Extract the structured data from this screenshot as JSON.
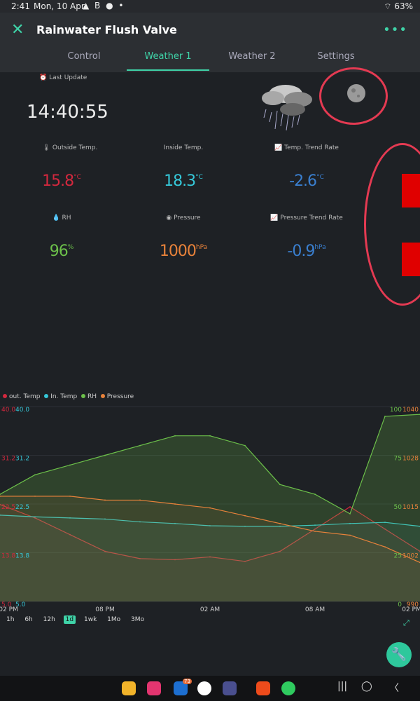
{
  "status": {
    "time": "2:41",
    "date": "Mon, 10 Apr",
    "battery": "63%"
  },
  "app": {
    "title": "Rainwater Flush Valve"
  },
  "tabs": [
    {
      "label": "Control"
    },
    {
      "label": "Weather 1"
    },
    {
      "label": "Weather 2"
    },
    {
      "label": "Settings"
    }
  ],
  "last_update": {
    "label": "Last Update",
    "time": "14:40:55"
  },
  "metrics": {
    "outside": {
      "label": "Outside Temp.",
      "value": "15.8",
      "unit": "°C",
      "color": "#d3283e"
    },
    "inside": {
      "label": "Inside Temp.",
      "value": "18.3",
      "unit": "°C",
      "color": "#35c7d8"
    },
    "trend": {
      "label": "Temp. Trend Rate",
      "value": "-2.6",
      "unit": "°C",
      "color": "#3a7fcf"
    },
    "rh": {
      "label": "RH",
      "value": "96",
      "unit": "%",
      "color": "#6cc04a"
    },
    "pressure": {
      "label": "Pressure",
      "value": "1000",
      "unit": "hPa",
      "color": "#e8823a"
    },
    "ptrend": {
      "label": "Pressure Trend Rate",
      "value": "-0.9",
      "unit": "hPa",
      "color": "#3a7fcf"
    }
  },
  "legend": [
    {
      "name": "out. Temp",
      "color": "#d3283e"
    },
    {
      "name": "In. Temp",
      "color": "#35c7d8"
    },
    {
      "name": "RH",
      "color": "#6cc04a"
    },
    {
      "name": "Pressure",
      "color": "#e8823a"
    }
  ],
  "chart_data": {
    "type": "line",
    "x_ticks": [
      "02 PM",
      "08 PM",
      "02 AM",
      "08 AM",
      "02 PM"
    ],
    "left_ticks_out": [
      "40.0",
      "31.2",
      "22.5",
      "13.8",
      "5.0"
    ],
    "left_ticks_in": [
      "40.0",
      "31.2",
      "22.5",
      "13.8",
      "5.0"
    ],
    "right_ticks_rh": [
      "100",
      "75",
      "50",
      "25",
      "0"
    ],
    "right_ticks_p": [
      "1040",
      "1028",
      "1015",
      "1002",
      "990"
    ],
    "ylim_temp": [
      5.0,
      40.0
    ],
    "ylim_rh": [
      0,
      100
    ],
    "ylim_pressure": [
      990,
      1040
    ],
    "series": [
      {
        "name": "out. Temp",
        "color": "#d3283e",
        "x": [
          0,
          2,
          4,
          6,
          8,
          10,
          12,
          14,
          16,
          18,
          20,
          22,
          24
        ],
        "values": [
          22.4,
          20,
          17,
          14,
          12.7,
          12.5,
          13,
          12.2,
          14,
          18,
          22,
          18,
          14
        ]
      },
      {
        "name": "In. Temp",
        "color": "#35c7d8",
        "x": [
          0,
          2,
          4,
          6,
          8,
          10,
          12,
          14,
          16,
          18,
          20,
          22,
          24
        ],
        "values": [
          20.5,
          20.2,
          20,
          19.8,
          19.3,
          19,
          18.6,
          18.5,
          18.5,
          18.7,
          19,
          19.2,
          18.5
        ]
      },
      {
        "name": "RH",
        "color": "#6cc04a",
        "x": [
          0,
          2,
          4,
          6,
          8,
          10,
          12,
          14,
          16,
          18,
          20,
          22,
          24
        ],
        "values": [
          55,
          65,
          70,
          75,
          80,
          85,
          85,
          80,
          60,
          55,
          45,
          95,
          96
        ]
      },
      {
        "name": "Pressure",
        "color": "#e8823a",
        "x": [
          0,
          2,
          4,
          6,
          8,
          10,
          12,
          14,
          16,
          18,
          20,
          22,
          24
        ],
        "values": [
          1017,
          1017,
          1017,
          1016,
          1016,
          1015,
          1014,
          1012,
          1010,
          1008,
          1007,
          1004,
          1000
        ]
      }
    ]
  },
  "ranges": [
    {
      "label": "1h"
    },
    {
      "label": "6h"
    },
    {
      "label": "12h"
    },
    {
      "label": "1d"
    },
    {
      "label": "1wk"
    },
    {
      "label": "1Mo"
    },
    {
      "label": "3Mo"
    }
  ],
  "navbar": {
    "badge": "73"
  }
}
